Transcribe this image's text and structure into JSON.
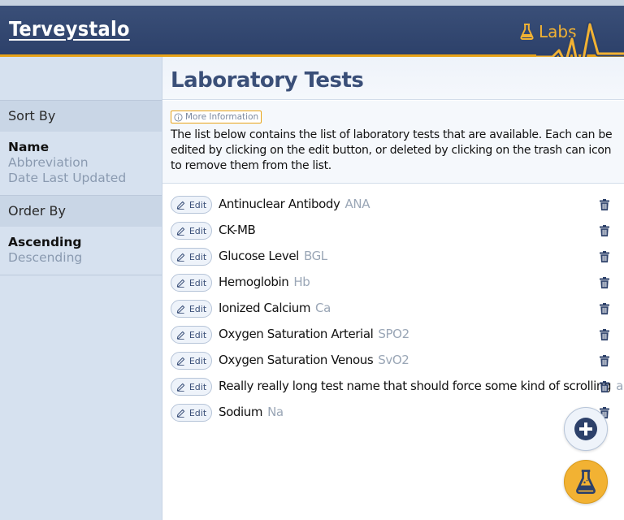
{
  "header": {
    "brand": "Terveystalo",
    "section_label": "Labs",
    "accent_color": "#e8a317",
    "bar_color": "#2d416a"
  },
  "sidebar": {
    "sort_by_label": "Sort By",
    "sort_options": [
      {
        "label": "Name",
        "active": true
      },
      {
        "label": "Abbreviation",
        "active": false
      },
      {
        "label": "Date Last Updated",
        "active": false
      }
    ],
    "order_by_label": "Order By",
    "order_options": [
      {
        "label": "Ascending",
        "active": true
      },
      {
        "label": "Descending",
        "active": false
      }
    ]
  },
  "main": {
    "title": "Laboratory Tests",
    "more_info_label": "More Information",
    "description": "The list below contains the list of laboratory tests that are available. Each can be edited by clicking on the edit button, or deleted by clicking on the trash can icon to remove them from the list.",
    "edit_label": "Edit",
    "tests": [
      {
        "name": "Antinuclear Antibody",
        "abbr": "ANA"
      },
      {
        "name": "CK-MB",
        "abbr": ""
      },
      {
        "name": "Glucose Level",
        "abbr": "BGL"
      },
      {
        "name": "Hemoglobin",
        "abbr": "Hb"
      },
      {
        "name": "Ionized Calcium",
        "abbr": "Ca"
      },
      {
        "name": "Oxygen Saturation Arterial",
        "abbr": "SPO2"
      },
      {
        "name": "Oxygen Saturation Venous",
        "abbr": "SvO2"
      },
      {
        "name": "Really really long test name that should force some kind of scrolling",
        "abbr": "abcde"
      },
      {
        "name": "Sodium",
        "abbr": "Na"
      }
    ]
  },
  "icons": {
    "flask": "flask-icon",
    "info": "info-icon",
    "edit": "pencil-icon",
    "trash": "trash-icon",
    "add": "plus-circle-icon"
  }
}
